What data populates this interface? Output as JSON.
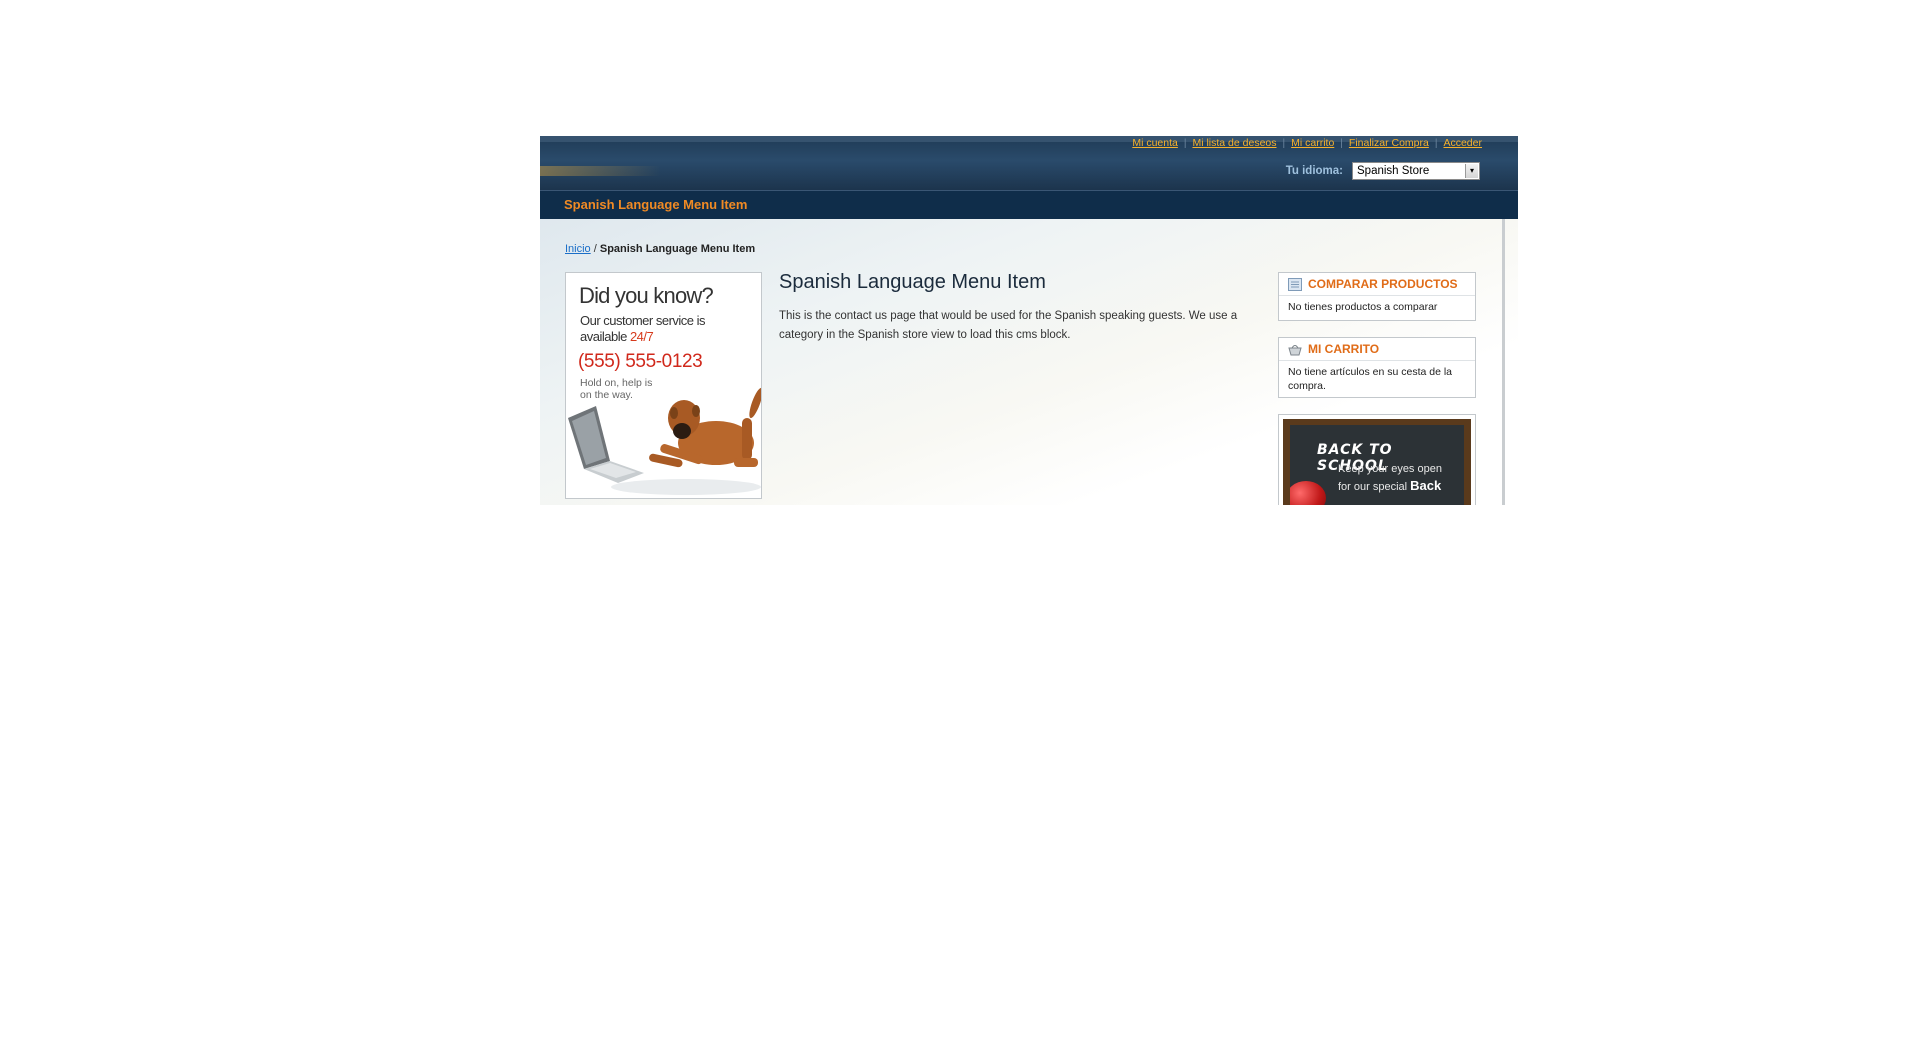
{
  "header": {
    "quick_links": [
      "Mi cuenta",
      "Mi lista de deseos",
      "Mi carrito",
      "Finalizar Compra",
      "Acceder"
    ],
    "language_label": "Tu idioma:",
    "language_selected": "Spanish Store"
  },
  "nav": {
    "item": "Spanish Language Menu Item"
  },
  "breadcrumb": {
    "home": "Inicio",
    "separator": " / ",
    "current": "Spanish Language Menu Item"
  },
  "left_banner": {
    "title": "Did you know?",
    "line1": "Our customer service is",
    "line2_prefix": "available ",
    "line2_highlight": "24/7",
    "phone": "(555) 555-0123",
    "note": "Hold on, help is on the way."
  },
  "main": {
    "title": "Spanish Language Menu Item",
    "text": "This is the contact us page that would be used for the Spanish speaking guests. We use a category in the Spanish store view to load this cms block."
  },
  "sidebar": {
    "compare": {
      "title": "COMPARAR PRODUCTOS",
      "text": "No tienes productos a comparar",
      "icon": "compare-list-icon"
    },
    "cart": {
      "title": "MI CARRITO",
      "text": "No tiene artículos en su cesta de la compra.",
      "icon": "cart-basket-icon"
    },
    "promo": {
      "title": "BACK TO SCHOOL",
      "line1": "Keep your eyes open",
      "line2_prefix": "for our special ",
      "line2_bold": "Back"
    }
  },
  "colors": {
    "link_orange": "#f7b12b",
    "nav_orange": "#f08a24",
    "header_blue": "#1f3a55",
    "box_title": "#e06c18"
  }
}
